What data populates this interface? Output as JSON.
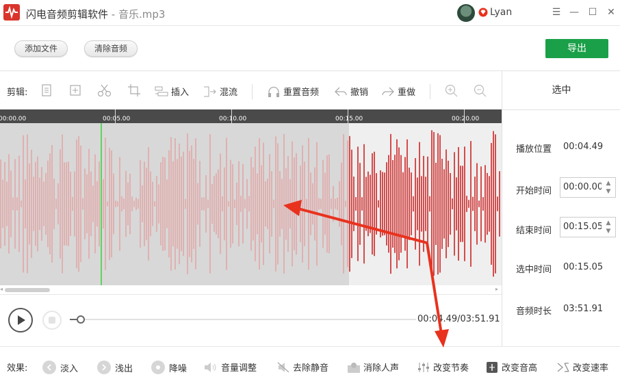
{
  "titlebar": {
    "app_name": "闪电音频剪辑软件",
    "separator": " - ",
    "file_name": "音乐.mp3",
    "username": "Lyan",
    "menu_glyph": "☰",
    "minimize_glyph": "—",
    "maximize_glyph": "☐",
    "close_glyph": "✕"
  },
  "actions": {
    "add_file": "添加文件",
    "clear_audio": "清除音频",
    "export": "导出"
  },
  "toolbar": {
    "edit_label": "剪辑:",
    "insert": "插入",
    "mix": "混流",
    "reset_audio": "重置音频",
    "undo": "撤销",
    "redo": "重做",
    "icons": [
      "copy-icon",
      "paste-icon",
      "cut-icon",
      "crop-icon",
      "insert-icon",
      "mix-icon",
      "reset-icon",
      "undo-icon",
      "redo-icon",
      "zoom-in-icon",
      "zoom-out-icon"
    ]
  },
  "ruler": {
    "labels": [
      "00:00.00",
      "00:05.00",
      "00:10.00",
      "00:15.00",
      "00:20.00"
    ]
  },
  "transport": {
    "time_readout": "00:04.49/03:51.91",
    "progress": 0.019
  },
  "panel": {
    "header": "选中",
    "play_position_label": "播放位置",
    "play_position_value": "00:04.49",
    "start_time_label": "开始时间",
    "start_time_value": "00:00.00",
    "end_time_label": "结束时间",
    "end_time_value": "00:15.05",
    "selected_time_label": "选中时间",
    "selected_time_value": "00:15.05",
    "duration_label": "音频时长",
    "duration_value": "03:51.91",
    "spin_up": "▲",
    "spin_down": "▼"
  },
  "effects": {
    "label": "效果:",
    "fade_in": "淡入",
    "fade_out": "浅出",
    "denoise": "降噪",
    "volume": "音量调整",
    "remove_silence": "去除静音",
    "remove_vocals": "消除人声",
    "change_tempo": "改变节奏",
    "change_pitch": "改变音高",
    "change_speed": "改变速率"
  },
  "colors": {
    "brand": "#d9342b",
    "export_green": "#1aa048",
    "waveform_selected": "#e3a0a0",
    "waveform_unselected": "#cc2222",
    "playhead": "#5fd35f",
    "annotation_arrow": "#e8321e"
  }
}
